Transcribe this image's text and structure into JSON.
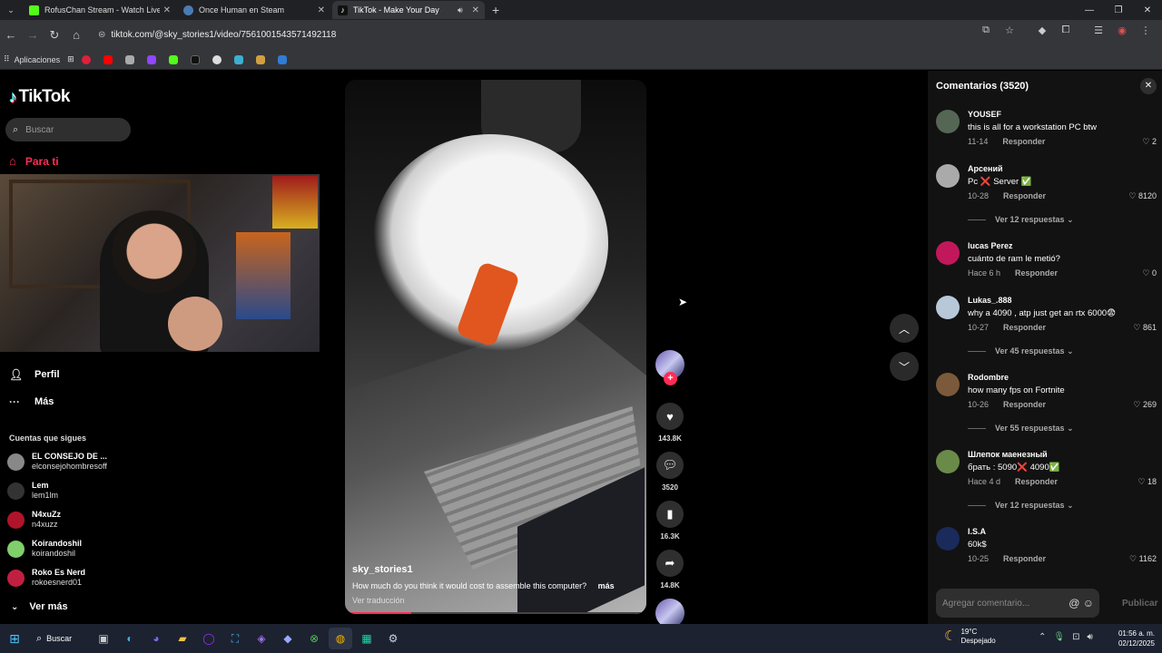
{
  "browser": {
    "tabs": [
      {
        "title": "RofusChan Stream - Watch Live",
        "color": "#53fc18",
        "active": false
      },
      {
        "title": "Once Human en Steam",
        "color": "#1b2838",
        "active": false
      },
      {
        "title": "TikTok - Make Your Day",
        "color": "#111111",
        "active": true
      }
    ],
    "url": "tiktok.com/@sky_stories1/video/7561001543571492118",
    "bookmarks_label": "Aplicaciones"
  },
  "tiktok": {
    "logo": "TikTok",
    "search_placeholder": "Buscar",
    "for_you": "Para ti",
    "profile": "Perfil",
    "more": "Más",
    "following_header": "Cuentas que sigues",
    "following": [
      {
        "name": "EL CONSEJO DE ...",
        "handle": "elconsejohombresoff",
        "color": "#888888"
      },
      {
        "name": "Lem",
        "handle": "lem1lm",
        "color": "#333333"
      },
      {
        "name": "N4xuZz",
        "handle": "n4xuzz",
        "color": "#b0142a"
      },
      {
        "name": "Koirandoshil",
        "handle": "koirandoshil",
        "color": "#7fcf6a"
      },
      {
        "name": "Roko Es Nerd",
        "handle": "rokoesnerd01",
        "color": "#c02040"
      }
    ],
    "see_more": "Ver más",
    "video": {
      "username": "sky_stories1",
      "description": "How much do you think it would cost to assemble this computer?",
      "more": "más",
      "translate": "Ver traducción",
      "progress": 0.22
    },
    "actions": {
      "likes": "143.8K",
      "comments": "3520",
      "saves": "16.3K",
      "shares": "14.8K"
    },
    "comments_panel": {
      "title": "Comentarios (3520)",
      "reply_label": "Responder",
      "input_placeholder": "Agregar comentario...",
      "post_label": "Publicar",
      "comments": [
        {
          "user": "YOUSEF",
          "text": "this is all for a workstation PC btw",
          "date": "11-14",
          "likes": "2",
          "replies": "",
          "color": "#556655"
        },
        {
          "user": "Арсений",
          "text": "Pc ❌ Server ✅",
          "date": "10-28",
          "likes": "8120",
          "replies": "Ver 12 respuestas",
          "color": "#aaaaaa"
        },
        {
          "user": "lucas Perez",
          "text": "cuánto de ram le metió?",
          "date": "Hace 6 h",
          "likes": "0",
          "replies": "",
          "color": "#c2185b"
        },
        {
          "user": "Lukas_.888",
          "text": "why a 4090 , atp just get an rtx 6000😨",
          "date": "10-27",
          "likes": "861",
          "replies": "Ver 45 respuestas",
          "color": "#b8c8d8"
        },
        {
          "user": "Rodombre",
          "text": "how many fps on Fortnite",
          "date": "10-26",
          "likes": "269",
          "replies": "Ver 55 respuestas",
          "color": "#7a5a3a"
        },
        {
          "user": "Шлепок маенезный",
          "text": "брать : 5090❌ 4090✅",
          "date": "Hace 4 d",
          "likes": "18",
          "replies": "Ver 12 respuestas",
          "color": "#6a8a4a"
        },
        {
          "user": "I.S.A",
          "text": "60k$",
          "date": "10-25",
          "likes": "1162",
          "replies": "",
          "color": "#1a2a5a"
        }
      ]
    }
  },
  "taskbar": {
    "search": "Buscar",
    "temperature": "19°C",
    "weather": "Despejado",
    "time": "01:56 a. m.",
    "date": "02/12/2025"
  }
}
